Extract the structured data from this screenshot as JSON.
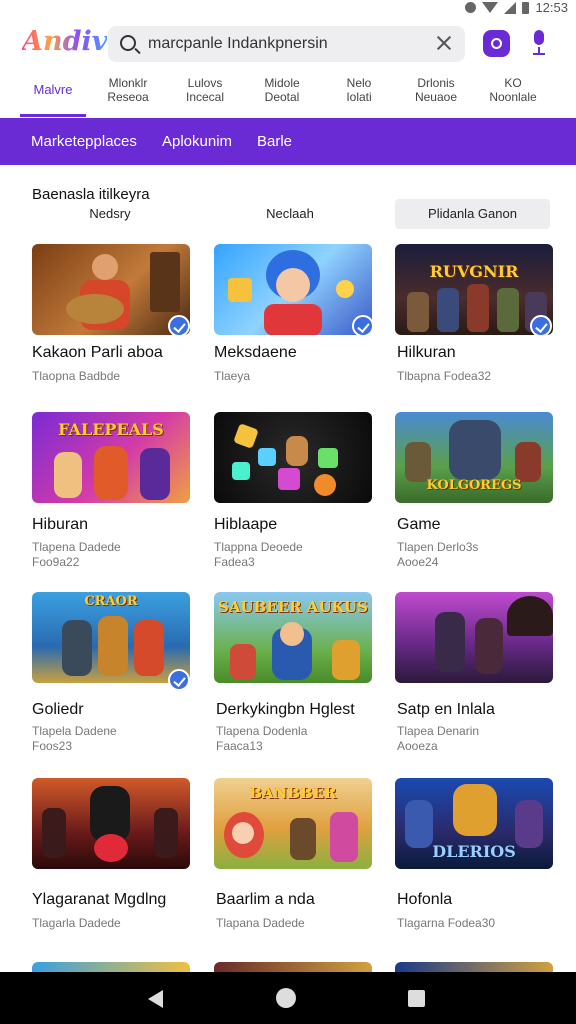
{
  "status": {
    "time": "12:53"
  },
  "app": {
    "logo": "Andiv"
  },
  "search": {
    "value": "marcpanle Indankpnersin"
  },
  "tabs": [
    {
      "l1": "Malvre",
      "l2": ""
    },
    {
      "l1": "Mlonklr",
      "l2": "Reseoa"
    },
    {
      "l1": "Lulovs",
      "l2": "Incecal"
    },
    {
      "l1": "Midole",
      "l2": "Deotal"
    },
    {
      "l1": "Nelo",
      "l2": "Iolati"
    },
    {
      "l1": "Drlonis",
      "l2": "Neuaoe"
    },
    {
      "l1": "KO",
      "l2": "Noonlale"
    }
  ],
  "categories": [
    "Marketepplaces",
    "Aplokunim",
    "Barle"
  ],
  "filter": {
    "title": "Baenasla itilkeyra",
    "chips": [
      "Nedsry",
      "Neclaah",
      "Plidanla Ganon"
    ]
  },
  "cards": [
    {
      "title": "Kakaon Parli aboa",
      "meta1": "Tlaopna Badbde",
      "meta2": "",
      "verified": true
    },
    {
      "title": "Meksdaene",
      "meta1": "Tlaeya",
      "meta2": "",
      "verified": true
    },
    {
      "title": "Hilkuran",
      "meta1": "Tlbapna Fodea32",
      "meta2": "",
      "verified": true
    },
    {
      "title": "Hiburan",
      "meta1": "Tlapena Dadede",
      "meta2": "Foo9a22",
      "verified": false
    },
    {
      "title": "Hiblaape",
      "meta1": "Tlappna Deoede",
      "meta2": "Fadea3",
      "verified": false
    },
    {
      "title": "Game",
      "meta1": "Tlapen Derlo3s",
      "meta2": "Aooe24",
      "verified": false
    },
    {
      "title": "Goliedr",
      "meta1": "Tlapela Dadene",
      "meta2": "Foos23",
      "verified": true
    },
    {
      "title": "Derkykingbn Hglest",
      "meta1": "Tlapena Dodenla",
      "meta2": "Faaca13",
      "verified": false
    },
    {
      "title": "Satp en Inlala",
      "meta1": "Tlapea Denarin",
      "meta2": "Aooeza",
      "verified": false
    },
    {
      "title": "Ylagaranat Mgdlng",
      "meta1": "Tlagarla Dadede",
      "meta2": "",
      "verified": false
    },
    {
      "title": "Baarlim a nda",
      "meta1": "Tlapana Dadede",
      "meta2": "",
      "verified": false
    },
    {
      "title": "Hofonla",
      "meta1": "Tlagarna Fodea30",
      "meta2": "",
      "verified": false
    }
  ],
  "banners": {
    "c3": "RUVGNIR",
    "c4": "FALEPEALS",
    "c6": "KOLGOREGS",
    "c7": "CRAOR",
    "c8": "SAUBEER AUKUS",
    "c11": "BANBBER",
    "c12": "DLERIOS"
  }
}
